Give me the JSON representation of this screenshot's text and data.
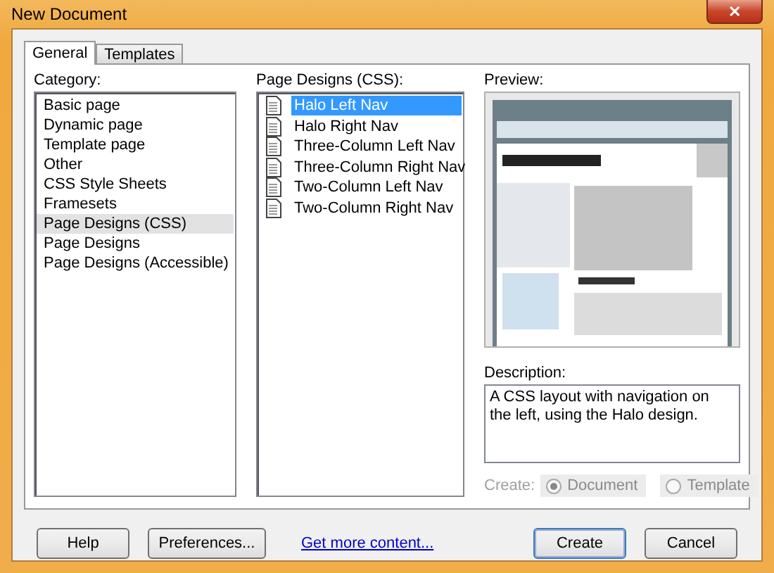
{
  "window": {
    "title": "New Document",
    "close": "✕"
  },
  "tabs": [
    {
      "label": "General",
      "selected": true
    },
    {
      "label": "Templates",
      "selected": false
    }
  ],
  "category": {
    "label": "Category:",
    "items": [
      {
        "label": "Basic page",
        "selected": false
      },
      {
        "label": "Dynamic page",
        "selected": false
      },
      {
        "label": "Template page",
        "selected": false
      },
      {
        "label": "Other",
        "selected": false
      },
      {
        "label": "CSS Style Sheets",
        "selected": false
      },
      {
        "label": "Framesets",
        "selected": false
      },
      {
        "label": "Page Designs (CSS)",
        "selected": true
      },
      {
        "label": "Page Designs",
        "selected": false
      },
      {
        "label": "Page Designs (Accessible)",
        "selected": false
      }
    ]
  },
  "designs": {
    "label": "Page Designs (CSS):",
    "items": [
      {
        "label": "Halo Left Nav",
        "selected": true
      },
      {
        "label": "Halo Right Nav",
        "selected": false
      },
      {
        "label": "Three-Column Left Nav",
        "selected": false
      },
      {
        "label": "Three-Column Right Nav",
        "selected": false
      },
      {
        "label": "Two-Column Left Nav",
        "selected": false
      },
      {
        "label": "Two-Column Right Nav",
        "selected": false
      }
    ]
  },
  "preview": {
    "label": "Preview:",
    "kind": "picture"
  },
  "description": {
    "label": "Description:",
    "text": "A CSS layout with navigation on the left, using the Halo design."
  },
  "create": {
    "label": "Create:",
    "disabled": true,
    "options": [
      {
        "label": "Document",
        "selected": true
      },
      {
        "label": "Template",
        "selected": false
      }
    ]
  },
  "buttons_left": [
    "Help",
    "Preferences..."
  ],
  "link": "Get more content...",
  "buttons_right": [
    {
      "label": "Create",
      "default": true
    },
    {
      "label": "Cancel",
      "default": false
    }
  ]
}
